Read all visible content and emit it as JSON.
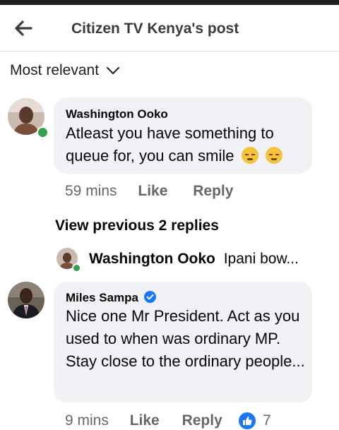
{
  "header": {
    "title": "Citizen TV Kenya's post"
  },
  "sort": {
    "label": "Most relevant"
  },
  "comments": [
    {
      "name": "Washington Ooko",
      "text": "Atleast you have something to queue for, you can smile",
      "emojis": [
        "sleepy-face-icon",
        "sleepy-face-icon"
      ],
      "time": "59 mins",
      "like_label": "Like",
      "reply_label": "Reply"
    },
    {
      "name": "Miles Sampa",
      "verified": true,
      "text": "Nice one Mr President. Act as you used to when was ordinary MP. Stay close to the ordinary people...",
      "time": "9 mins",
      "like_label": "Like",
      "reply_label": "Reply",
      "reaction_count": "7"
    }
  ],
  "view_previous": {
    "label": "View previous 2 replies"
  },
  "reply_preview": {
    "name": "Washington Ooko",
    "text": "Ipani bow..."
  },
  "colors": {
    "accent": "#1877f2",
    "online": "#31a24c",
    "bubble": "#f0f2f5"
  }
}
